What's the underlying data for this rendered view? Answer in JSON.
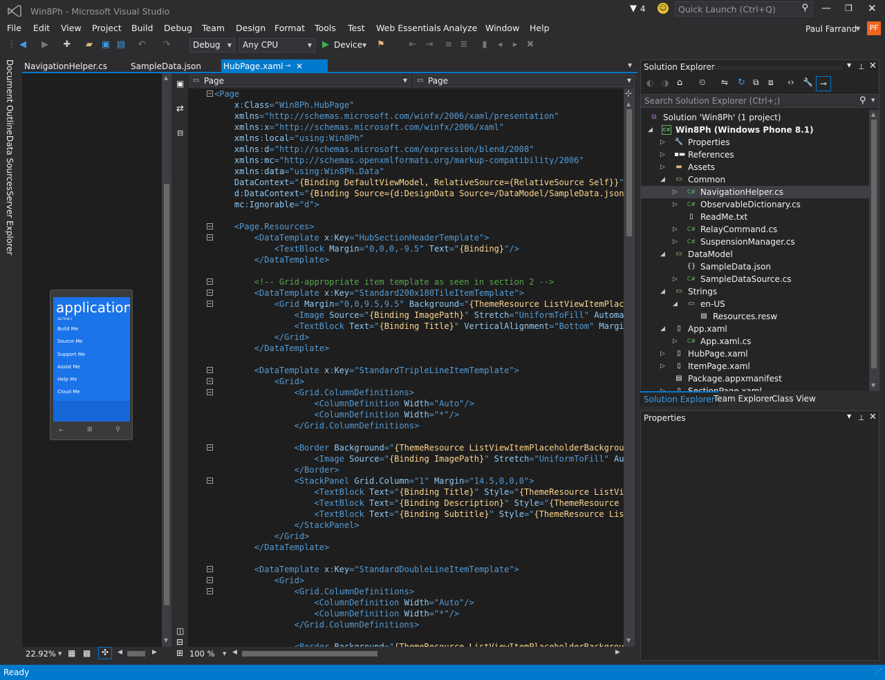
{
  "window": {
    "title": "Win8Ph - Microsoft Visual Studio",
    "notification_count": "4",
    "quick_launch_placeholder": "Quick Launch (Ctrl+Q)",
    "user_name": "Paul Farrand",
    "user_initials": "PF"
  },
  "menu": [
    "File",
    "Edit",
    "View",
    "Project",
    "Build",
    "Debug",
    "Team",
    "Design",
    "Format",
    "Tools",
    "Test",
    "Web Essentials",
    "Analyze",
    "Window",
    "Help"
  ],
  "toolbar": {
    "config": "Debug",
    "platform": "Any CPU",
    "run_target": "Device"
  },
  "doc_tabs": [
    "NavigationHelper.cs",
    "SampleData.json",
    "HubPage.xaml"
  ],
  "left_strip": [
    "Document Outline",
    "Data Sources",
    "Server Explorer"
  ],
  "designer": {
    "phone_title": "application r",
    "section": "SECTION 1",
    "items": [
      "Build Me",
      "Source Me",
      "Support Me",
      "Assist Me",
      "Help Me",
      "Cloud Me"
    ],
    "zoom": "22.92%"
  },
  "editor": {
    "nav_left": "Page",
    "nav_right": "Page",
    "zoom": "100 %"
  },
  "solution_explorer": {
    "title": "Solution Explorer",
    "search_placeholder": "Search Solution Explorer (Ctrl+;)",
    "items": [
      {
        "label": "Solution 'Win8Ph' (1 project)",
        "icon": "solution-icon"
      },
      {
        "label": "Win8Ph (Windows Phone 8.1)",
        "icon": "csharp-project-icon"
      },
      {
        "label": "Properties",
        "icon": "wrench-icon"
      },
      {
        "label": "References",
        "icon": "references-icon"
      },
      {
        "label": "Assets",
        "icon": "folder-icon"
      },
      {
        "label": "Common",
        "icon": "folder-open-icon"
      },
      {
        "label": "NavigationHelper.cs",
        "icon": "csharp-file-icon"
      },
      {
        "label": "ObservableDictionary.cs",
        "icon": "csharp-file-icon"
      },
      {
        "label": "ReadMe.txt",
        "icon": "text-file-icon"
      },
      {
        "label": "RelayCommand.cs",
        "icon": "csharp-file-icon"
      },
      {
        "label": "SuspensionManager.cs",
        "icon": "csharp-file-icon"
      },
      {
        "label": "DataModel",
        "icon": "folder-open-icon"
      },
      {
        "label": "SampleData.json",
        "icon": "json-file-icon"
      },
      {
        "label": "SampleDataSource.cs",
        "icon": "csharp-file-icon"
      },
      {
        "label": "Strings",
        "icon": "folder-open-icon"
      },
      {
        "label": "en-US",
        "icon": "folder-open-icon"
      },
      {
        "label": "Resources.resw",
        "icon": "resource-file-icon"
      },
      {
        "label": "App.xaml",
        "icon": "xaml-file-icon"
      },
      {
        "label": "App.xaml.cs",
        "icon": "csharp-file-icon"
      },
      {
        "label": "HubPage.xaml",
        "icon": "xaml-file-icon"
      },
      {
        "label": "ItemPage.xaml",
        "icon": "xaml-file-icon"
      },
      {
        "label": "Package.appxmanifest",
        "icon": "manifest-file-icon"
      },
      {
        "label": "SectionPage.xaml",
        "icon": "xaml-file-icon"
      }
    ],
    "tabs": [
      "Solution Explorer",
      "Team Explorer",
      "Class View"
    ]
  },
  "properties": {
    "title": "Properties"
  },
  "status": {
    "text": "Ready"
  },
  "colors": {
    "accent": "#007acc",
    "background": "#2d2d30",
    "editor": "#1e1e1e",
    "user_badge": "#f0641e"
  }
}
